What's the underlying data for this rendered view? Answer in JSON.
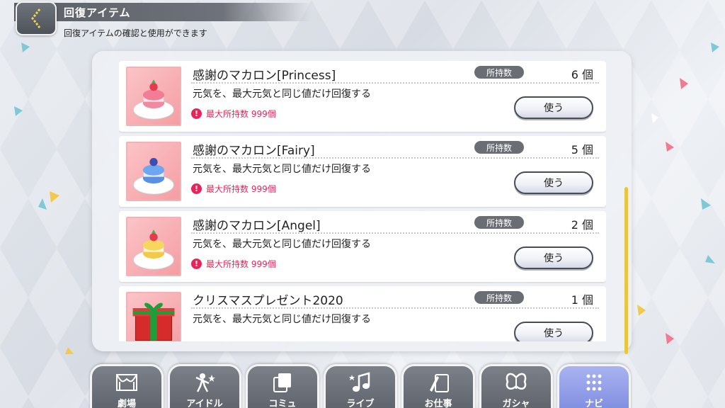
{
  "header": {
    "title": "回復アイテム",
    "subtitle": "回復アイテムの確認と使用ができます"
  },
  "items": [
    {
      "name": "感謝のマカロン[Princess]",
      "owned_label": "所持数",
      "count": "6 個",
      "description": "元気を、最大元気と同じ値だけ回復する",
      "limit": "最大所持数 999個",
      "use_label": "使う",
      "icon": "macaron-princess-icon"
    },
    {
      "name": "感謝のマカロン[Fairy]",
      "owned_label": "所持数",
      "count": "5 個",
      "description": "元気を、最大元気と同じ値だけ回復する",
      "limit": "最大所持数 999個",
      "use_label": "使う",
      "icon": "macaron-fairy-icon"
    },
    {
      "name": "感謝のマカロン[Angel]",
      "owned_label": "所持数",
      "count": "2 個",
      "description": "元気を、最大元気と同じ値だけ回復する",
      "limit": "最大所持数 999個",
      "use_label": "使う",
      "icon": "macaron-angel-icon"
    },
    {
      "name": "クリスマスプレゼント2020",
      "owned_label": "所持数",
      "count": "1 個",
      "description": "元気を、最大元気と同じ値だけ回復する",
      "limit": "",
      "use_label": "使う",
      "icon": "christmas-present-icon"
    }
  ],
  "nav": [
    {
      "label": "劇場",
      "icon": "theater-icon"
    },
    {
      "label": "アイドル",
      "icon": "idol-icon"
    },
    {
      "label": "コミュ",
      "icon": "commu-icon"
    },
    {
      "label": "ライブ",
      "icon": "live-icon"
    },
    {
      "label": "お仕事",
      "icon": "work-icon"
    },
    {
      "label": "ガシャ",
      "icon": "gacha-icon"
    },
    {
      "label": "ナビ",
      "icon": "navi-icon"
    }
  ],
  "colors": {
    "accent_pink": "#e8245a",
    "nav_active": "#8f9be6",
    "scrollbar": "#e9c640"
  }
}
